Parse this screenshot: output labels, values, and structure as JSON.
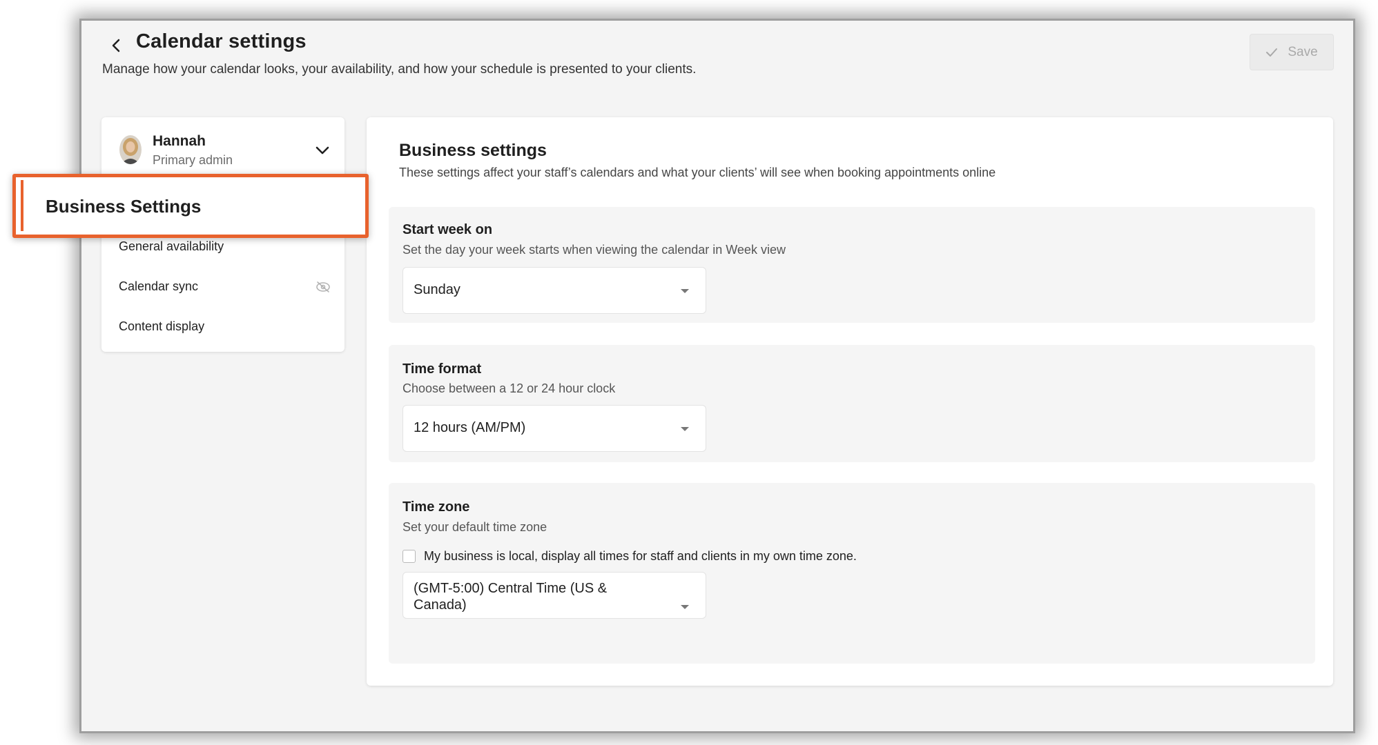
{
  "header": {
    "title": "Calendar settings",
    "subtitle": "Manage how your calendar looks, your availability, and how your schedule is presented to your clients.",
    "save_label": "Save"
  },
  "sidebar": {
    "user": {
      "name": "Hannah",
      "role": "Primary admin"
    },
    "active_item": "Business Settings",
    "items": [
      {
        "label": "General availability"
      },
      {
        "label": "Calendar sync"
      },
      {
        "label": "Content display"
      }
    ]
  },
  "main": {
    "title": "Business settings",
    "description": "These settings affect your staff’s calendars and what your clients’ will see when booking appointments online",
    "start_week": {
      "title": "Start week on",
      "description": "Set the day your week starts when viewing the calendar in Week view",
      "value": "Sunday"
    },
    "time_format": {
      "title": "Time format",
      "description": "Choose between a 12 or 24 hour clock",
      "value": "12 hours (AM/PM)"
    },
    "time_zone": {
      "title": "Time zone",
      "description": "Set your default time zone",
      "checkbox_label": "My business is local, display all times for staff and clients in my own time zone.",
      "checkbox_checked": false,
      "value": "(GMT-5:00) Central Time (US & Canada)"
    }
  },
  "colors": {
    "highlight": "#e8622d",
    "background": "#f4f4f4",
    "card": "#ffffff"
  }
}
